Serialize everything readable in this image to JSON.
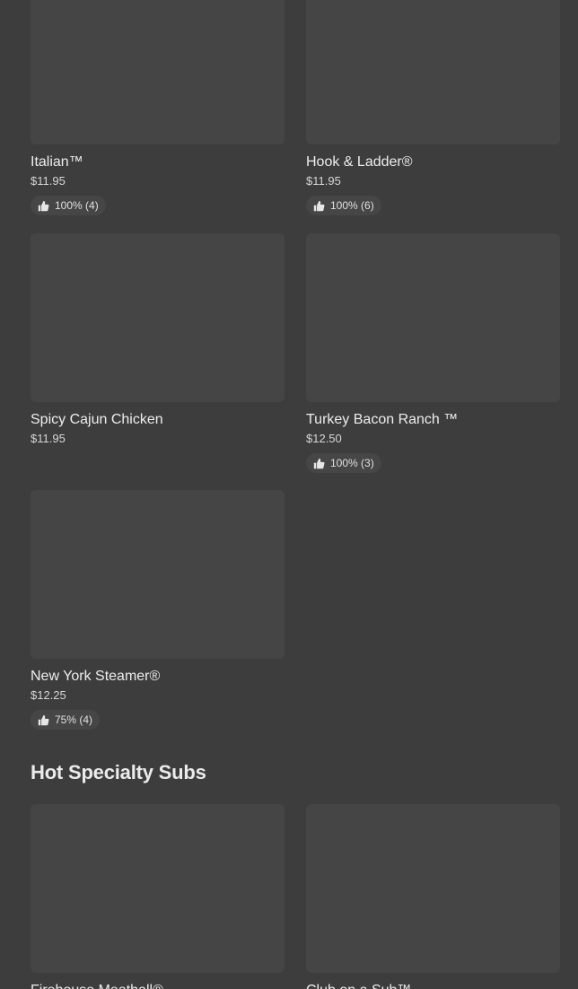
{
  "items_top": [
    {
      "name": "Italian™",
      "price": "$11.95",
      "rating": "100% (4)"
    },
    {
      "name": "Hook & Ladder®",
      "price": "$11.95",
      "rating": "100% (6)"
    },
    {
      "name": "Spicy Cajun Chicken",
      "price": "$11.95"
    },
    {
      "name": "Turkey Bacon Ranch ™",
      "price": "$12.50",
      "rating": "100% (3)"
    },
    {
      "name": "New York Steamer®",
      "price": "$12.25",
      "rating": "75% (4)"
    }
  ],
  "section": {
    "title": "Hot Specialty Subs"
  },
  "items_hot": [
    {
      "name": "Firehouse Meatball®"
    },
    {
      "name": "Club on a Sub™"
    }
  ],
  "icons": {
    "rating": "thumbs-up-icon"
  }
}
